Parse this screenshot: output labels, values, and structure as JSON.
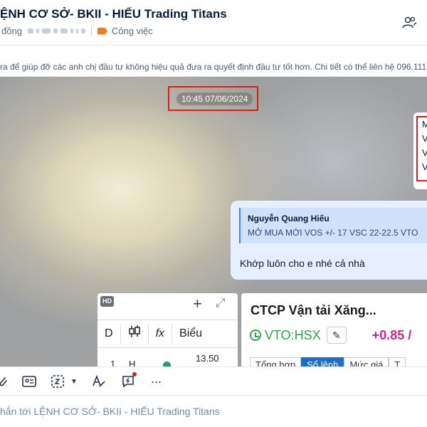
{
  "header": {
    "title": "ỆNH CƠ SỞ- BKII - HIẾU Trading Titans",
    "members_label": "đồng",
    "category_tag": "Công việc",
    "tag_color": "#f27a1a",
    "right_icon": "add-member-icon"
  },
  "banner": {
    "pinned_text": "ra để giúp đỡ các anh chị đầu tư không hiệu quả đưa ra quyết định đầu tư tốt hơn. Chi tiết có thể liên hệ 096.111.5003"
  },
  "chat": {
    "timestamp": "10:45 07/06/2024",
    "partial_card_lines": [
      "M",
      "V",
      "V",
      "V"
    ],
    "reply_bubble": {
      "quote_author": "Nguyễn Quang Hiếu",
      "quote_text": "MỞ MUA MỚI VOS +/- 17 VSC 22-22.5 VTO",
      "message": "Khớp luôn cho e nhé cả nhà"
    },
    "image_left": {
      "badge": "HD",
      "toolbar": [
        "D",
        "",
        "fx",
        "Biểu"
      ],
      "row_col1": "1",
      "row_col2": "H",
      "price": "13.50"
    },
    "image_right": {
      "company": "CTCP Vận tải Xăng...",
      "ticker": "VTO:HSX",
      "change": "+0.85 /",
      "tabs": [
        "Tổng hợp",
        "Sổ lệnh",
        "Mức giá",
        "T"
      ]
    }
  },
  "composer": {
    "toolbar_icons": [
      "attach-icon",
      "contact-card-icon",
      "screenshot-icon",
      "dropdown-icon",
      "text-format-icon",
      "quick-message-icon",
      "more-icon"
    ],
    "more_label": "···",
    "placeholder": "hắn tới LỆNH CƠ SỞ- BKII - HIẾU Trading Titans"
  },
  "colors": {
    "highlight_box": "#e11a1a",
    "ticker_green": "#2aa44f",
    "change_magenta": "#d4208c",
    "active_tab": "#1e6fc4"
  }
}
